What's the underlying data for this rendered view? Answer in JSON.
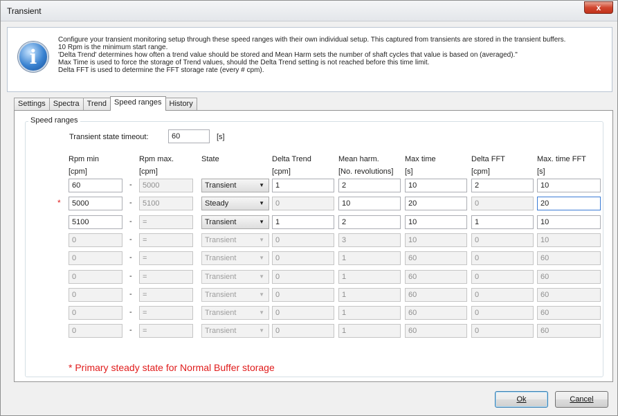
{
  "window": {
    "title": "Transient",
    "close_label": "x"
  },
  "info": {
    "icon": "info-icon",
    "icon_glyph": "i",
    "lines": [
      "Configure your transient monitoring setup through these speed ranges with their own individual setup. This captured from transients are stored in the transient buffers.",
      "10 Rpm is the minimum start range.",
      "'Delta Trend' determines how often a trend value should be stored and Mean Harm sets the number of shaft cycles that value is based on (averaged).\"",
      "Max Time is used to force the storage of Trend values, should the Delta Trend setting is not reached before this time limit.",
      "Delta FFT is used to determine the FFT storage rate (every # cpm)."
    ]
  },
  "tabs": [
    {
      "label": "Settings",
      "active": false
    },
    {
      "label": "Spectra",
      "active": false
    },
    {
      "label": "Trend",
      "active": false
    },
    {
      "label": "Speed ranges",
      "active": true
    },
    {
      "label": "History",
      "active": false
    }
  ],
  "speed_ranges": {
    "group_title": "Speed ranges",
    "timeout_label": "Transient state timeout:",
    "timeout_value": "60",
    "timeout_unit": "[s]",
    "columns": [
      {
        "name": "Rpm min",
        "unit": "[cpm]"
      },
      {
        "name": "Rpm max.",
        "unit": "[cpm]"
      },
      {
        "name": "State",
        "unit": ""
      },
      {
        "name": "Delta Trend",
        "unit": "[cpm]"
      },
      {
        "name": "Mean harm.",
        "unit": "[No. revolutions]"
      },
      {
        "name": "Max time",
        "unit": "[s]"
      },
      {
        "name": "Delta FFT",
        "unit": "[cpm]"
      },
      {
        "name": "Max. time FFT",
        "unit": "[s]"
      }
    ],
    "dash": "-",
    "rows": [
      {
        "rpm_min": "60",
        "rpm_max": "5000",
        "state": "Transient",
        "delta_trend": "1",
        "mean_harm": "2",
        "max_time": "10",
        "delta_fft": "2",
        "max_time_fft": "10",
        "enabled": true,
        "primary": false
      },
      {
        "rpm_min": "5000",
        "rpm_max": "5100",
        "state": "Steady",
        "delta_trend": "0",
        "mean_harm": "10",
        "max_time": "20",
        "delta_fft": "0",
        "max_time_fft": "20",
        "enabled": true,
        "primary": true
      },
      {
        "rpm_min": "5100",
        "rpm_max": "=",
        "state": "Transient",
        "delta_trend": "1",
        "mean_harm": "2",
        "max_time": "10",
        "delta_fft": "1",
        "max_time_fft": "10",
        "enabled": true,
        "primary": false
      },
      {
        "rpm_min": "0",
        "rpm_max": "=",
        "state": "Transient",
        "delta_trend": "0",
        "mean_harm": "3",
        "max_time": "10",
        "delta_fft": "0",
        "max_time_fft": "10",
        "enabled": false,
        "primary": false
      },
      {
        "rpm_min": "0",
        "rpm_max": "=",
        "state": "Transient",
        "delta_trend": "0",
        "mean_harm": "1",
        "max_time": "60",
        "delta_fft": "0",
        "max_time_fft": "60",
        "enabled": false,
        "primary": false
      },
      {
        "rpm_min": "0",
        "rpm_max": "=",
        "state": "Transient",
        "delta_trend": "0",
        "mean_harm": "1",
        "max_time": "60",
        "delta_fft": "0",
        "max_time_fft": "60",
        "enabled": false,
        "primary": false
      },
      {
        "rpm_min": "0",
        "rpm_max": "=",
        "state": "Transient",
        "delta_trend": "0",
        "mean_harm": "1",
        "max_time": "60",
        "delta_fft": "0",
        "max_time_fft": "60",
        "enabled": false,
        "primary": false
      },
      {
        "rpm_min": "0",
        "rpm_max": "=",
        "state": "Transient",
        "delta_trend": "0",
        "mean_harm": "1",
        "max_time": "60",
        "delta_fft": "0",
        "max_time_fft": "60",
        "enabled": false,
        "primary": false
      },
      {
        "rpm_min": "0",
        "rpm_max": "=",
        "state": "Transient",
        "delta_trend": "0",
        "mean_harm": "1",
        "max_time": "60",
        "delta_fft": "0",
        "max_time_fft": "60",
        "enabled": false,
        "primary": false
      }
    ],
    "primary_marker": "*",
    "footnote": "* Primary steady state for Normal Buffer storage",
    "footnote_color": "#e01b1b"
  },
  "buttons": {
    "ok": "Ok",
    "cancel": "Cancel"
  }
}
